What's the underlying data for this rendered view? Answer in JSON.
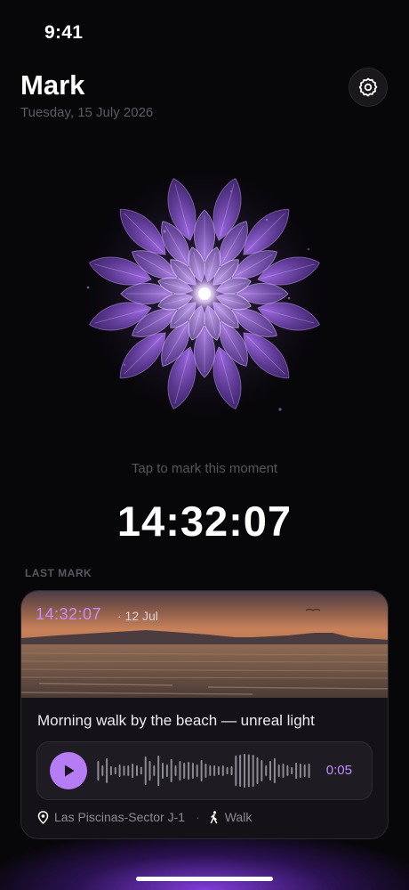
{
  "status_bar": {
    "time": "9:41"
  },
  "header": {
    "title": "Mark",
    "date": "Tuesday, 15 July 2026",
    "settings_icon": "gear-icon"
  },
  "mark_button": {
    "icon": "lotus-mandala",
    "hint": "Tap to mark this moment",
    "current_time": "14:32:07",
    "accent": "#b67cf3"
  },
  "last_mark": {
    "section_label": "LAST MARK",
    "time": "14:32:07",
    "date": "· 12 Jul",
    "caption": "Morning walk by the beach — unreal light",
    "audio": {
      "play_icon": "play-icon",
      "duration": "0:05"
    },
    "location": "Las Piscinas-Sector J-1",
    "separator": "·",
    "activity": "Walk",
    "location_icon": "location-pin-icon",
    "activity_icon": "walking-person-icon"
  }
}
